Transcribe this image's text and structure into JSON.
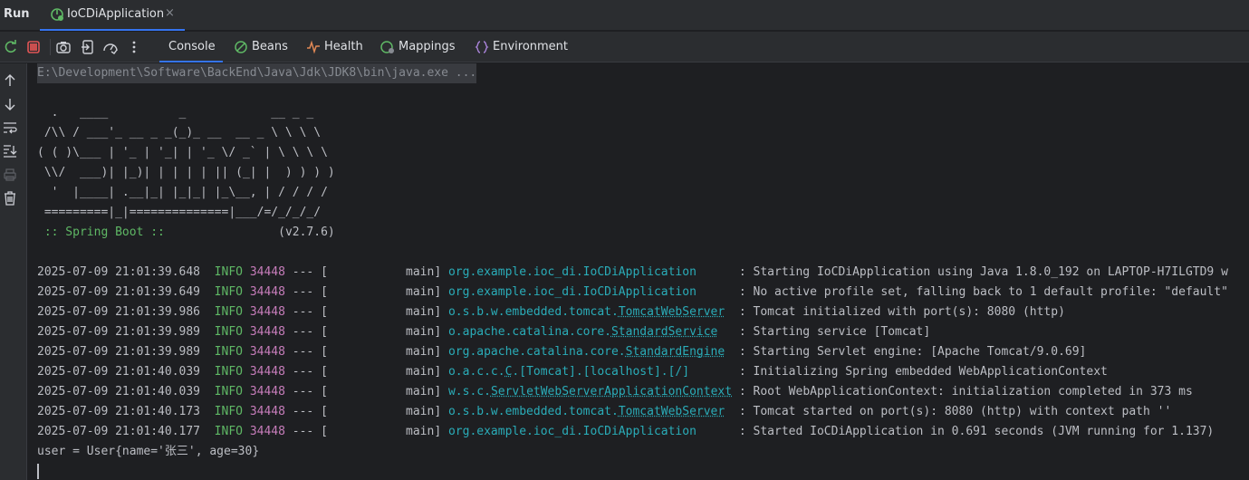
{
  "topbar": {
    "run_label": "Run",
    "tab_title": "IoCDiApplication",
    "close_glyph": "×"
  },
  "toolbar_icons": [
    "rerun-icon",
    "stop-icon",
    "camera-icon",
    "exit-icon",
    "dashboard-icon",
    "more-icon"
  ],
  "view_tabs": [
    {
      "label": "Console",
      "icon": ""
    },
    {
      "label": "Beans",
      "icon": "beans-icon"
    },
    {
      "label": "Health",
      "icon": "health-icon"
    },
    {
      "label": "Mappings",
      "icon": "mappings-icon"
    },
    {
      "label": "Environment",
      "icon": "environment-icon"
    }
  ],
  "sidebar_icons": [
    "scroll-up-icon",
    "scroll-down-icon",
    "soft-wrap-icon",
    "scroll-to-end-icon",
    "print-icon",
    "clear-icon"
  ],
  "console": {
    "command": "E:\\Development\\Software\\BackEnd\\Java\\Jdk\\JDK8\\bin\\java.exe ...",
    "banner": [
      "  .   ____          _            __ _ _",
      " /\\\\ / ___'_ __ _ _(_)_ __  __ _ \\ \\ \\ \\",
      "( ( )\\___ | '_ | '_| | '_ \\/ _` | \\ \\ \\ \\",
      " \\\\/  ___)| |_)| | | | | || (_| |  ) ) ) )",
      "  '  |____| .__|_| |_|_| |_\\__, | / / / /",
      " =========|_|==============|___/=/_/_/_/"
    ],
    "spring_boot_label": " :: Spring Boot :: ",
    "spring_boot_version": "               (v2.7.6)",
    "logs": [
      {
        "ts": "2025-07-09 21:01:39.648",
        "level": "INFO",
        "pid": "34448",
        "sep": " --- [           main] ",
        "logger": "org.example.ioc_di.IoCDiApplication",
        "logger_link": "",
        "logger_tail": "",
        "msg": "      : Starting IoCDiApplication using Java 1.8.0_192 on LAPTOP-H7ILGTD9 w"
      },
      {
        "ts": "2025-07-09 21:01:39.649",
        "level": "INFO",
        "pid": "34448",
        "sep": " --- [           main] ",
        "logger": "org.example.ioc_di.IoCDiApplication",
        "logger_link": "",
        "logger_tail": "",
        "msg": "      : No active profile set, falling back to 1 default profile: \"default\""
      },
      {
        "ts": "2025-07-09 21:01:39.986",
        "level": "INFO",
        "pid": "34448",
        "sep": " --- [           main] ",
        "logger": "o.s.b.w.embedded.tomcat.",
        "logger_link": "TomcatWebServer",
        "logger_tail": "",
        "msg": "  : Tomcat initialized with port(s): 8080 (http)"
      },
      {
        "ts": "2025-07-09 21:01:39.989",
        "level": "INFO",
        "pid": "34448",
        "sep": " --- [           main] ",
        "logger": "o.apache.catalina.core.",
        "logger_link": "StandardService",
        "logger_tail": "",
        "msg": "   : Starting service [Tomcat]"
      },
      {
        "ts": "2025-07-09 21:01:39.989",
        "level": "INFO",
        "pid": "34448",
        "sep": " --- [           main] ",
        "logger": "org.apache.catalina.core.",
        "logger_link": "StandardEngine",
        "logger_tail": "",
        "msg": "  : Starting Servlet engine: [Apache Tomcat/9.0.69]"
      },
      {
        "ts": "2025-07-09 21:01:40.039",
        "level": "INFO",
        "pid": "34448",
        "sep": " --- [           main] ",
        "logger": "o.a.c.c.",
        "logger_link": "C",
        "logger_tail": ".[Tomcat].[localhost].[/]",
        "msg": "       : Initializing Spring embedded WebApplicationContext"
      },
      {
        "ts": "2025-07-09 21:01:40.039",
        "level": "INFO",
        "pid": "34448",
        "sep": " --- [           main] ",
        "logger": "w.s.c.",
        "logger_link": "ServletWebServerApplicationContext",
        "logger_tail": "",
        "msg": " : Root WebApplicationContext: initialization completed in 373 ms"
      },
      {
        "ts": "2025-07-09 21:01:40.173",
        "level": "INFO",
        "pid": "34448",
        "sep": " --- [           main] ",
        "logger": "o.s.b.w.embedded.tomcat.",
        "logger_link": "TomcatWebServer",
        "logger_tail": "",
        "msg": "  : Tomcat started on port(s): 8080 (http) with context path ''"
      },
      {
        "ts": "2025-07-09 21:01:40.177",
        "level": "INFO",
        "pid": "34448",
        "sep": " --- [           main] ",
        "logger": "org.example.ioc_di.IoCDiApplication",
        "logger_link": "",
        "logger_tail": "",
        "msg": "      : Started IoCDiApplication in 0.691 seconds (JVM running for 1.137)"
      }
    ],
    "output": "user = User{name='张三', age=30}"
  },
  "colors": {
    "background": "#1e1f22",
    "panel": "#2b2d30",
    "accent": "#3574f0",
    "green": "#5fb865",
    "purple": "#c77dbb",
    "cyan": "#2aacb8"
  }
}
